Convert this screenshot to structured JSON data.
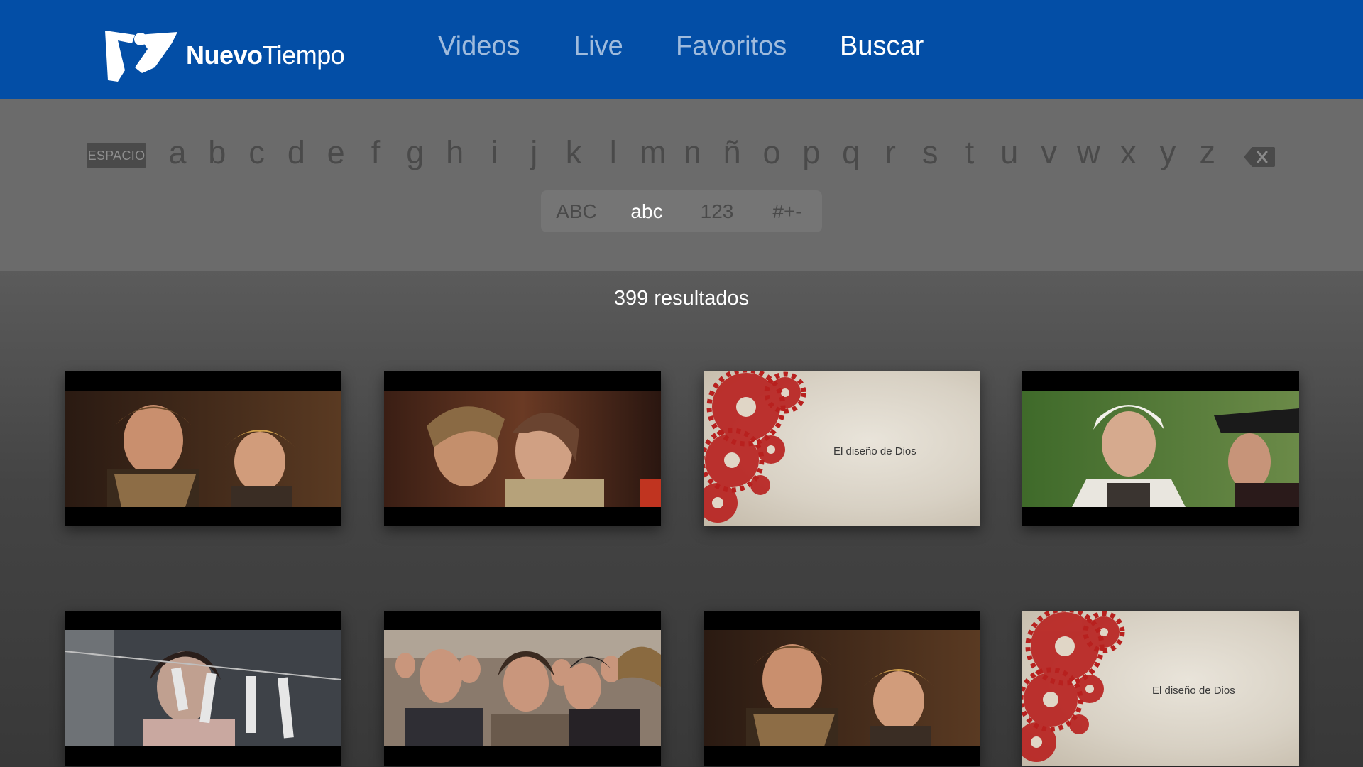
{
  "header": {
    "logo": {
      "bold": "Nuevo",
      "regular": "Tiempo"
    },
    "nav": [
      {
        "label": "Videos",
        "active": false
      },
      {
        "label": "Live",
        "active": false
      },
      {
        "label": "Favoritos",
        "active": false
      },
      {
        "label": "Buscar",
        "active": true
      }
    ]
  },
  "keyboard": {
    "space_label": "ESPACIO",
    "letters": [
      "a",
      "b",
      "c",
      "d",
      "e",
      "f",
      "g",
      "h",
      "i",
      "j",
      "k",
      "l",
      "m",
      "n",
      "ñ",
      "o",
      "p",
      "q",
      "r",
      "s",
      "t",
      "u",
      "v",
      "w",
      "x",
      "y",
      "z"
    ],
    "delete_icon": "backspace-icon",
    "modes": [
      {
        "label": "ABC",
        "active": false
      },
      {
        "label": "abc",
        "active": true
      },
      {
        "label": "123",
        "active": false
      },
      {
        "label": "#+-",
        "active": false
      }
    ]
  },
  "results": {
    "count_label": "399 resultados",
    "items": [
      {
        "kind": "photo",
        "caption": ""
      },
      {
        "kind": "photo",
        "caption": ""
      },
      {
        "kind": "title-card",
        "caption": "El diseño de Dios"
      },
      {
        "kind": "photo",
        "caption": ""
      },
      {
        "kind": "photo",
        "caption": ""
      },
      {
        "kind": "photo",
        "caption": ""
      },
      {
        "kind": "photo",
        "caption": ""
      },
      {
        "kind": "title-card",
        "caption": "El diseño de Dios"
      }
    ]
  },
  "colors": {
    "header_bg": "#034ea6",
    "keyboard_bg": "#6b6b6b",
    "inactive_text": "#4a4a4a",
    "active_text": "#ffffff"
  }
}
